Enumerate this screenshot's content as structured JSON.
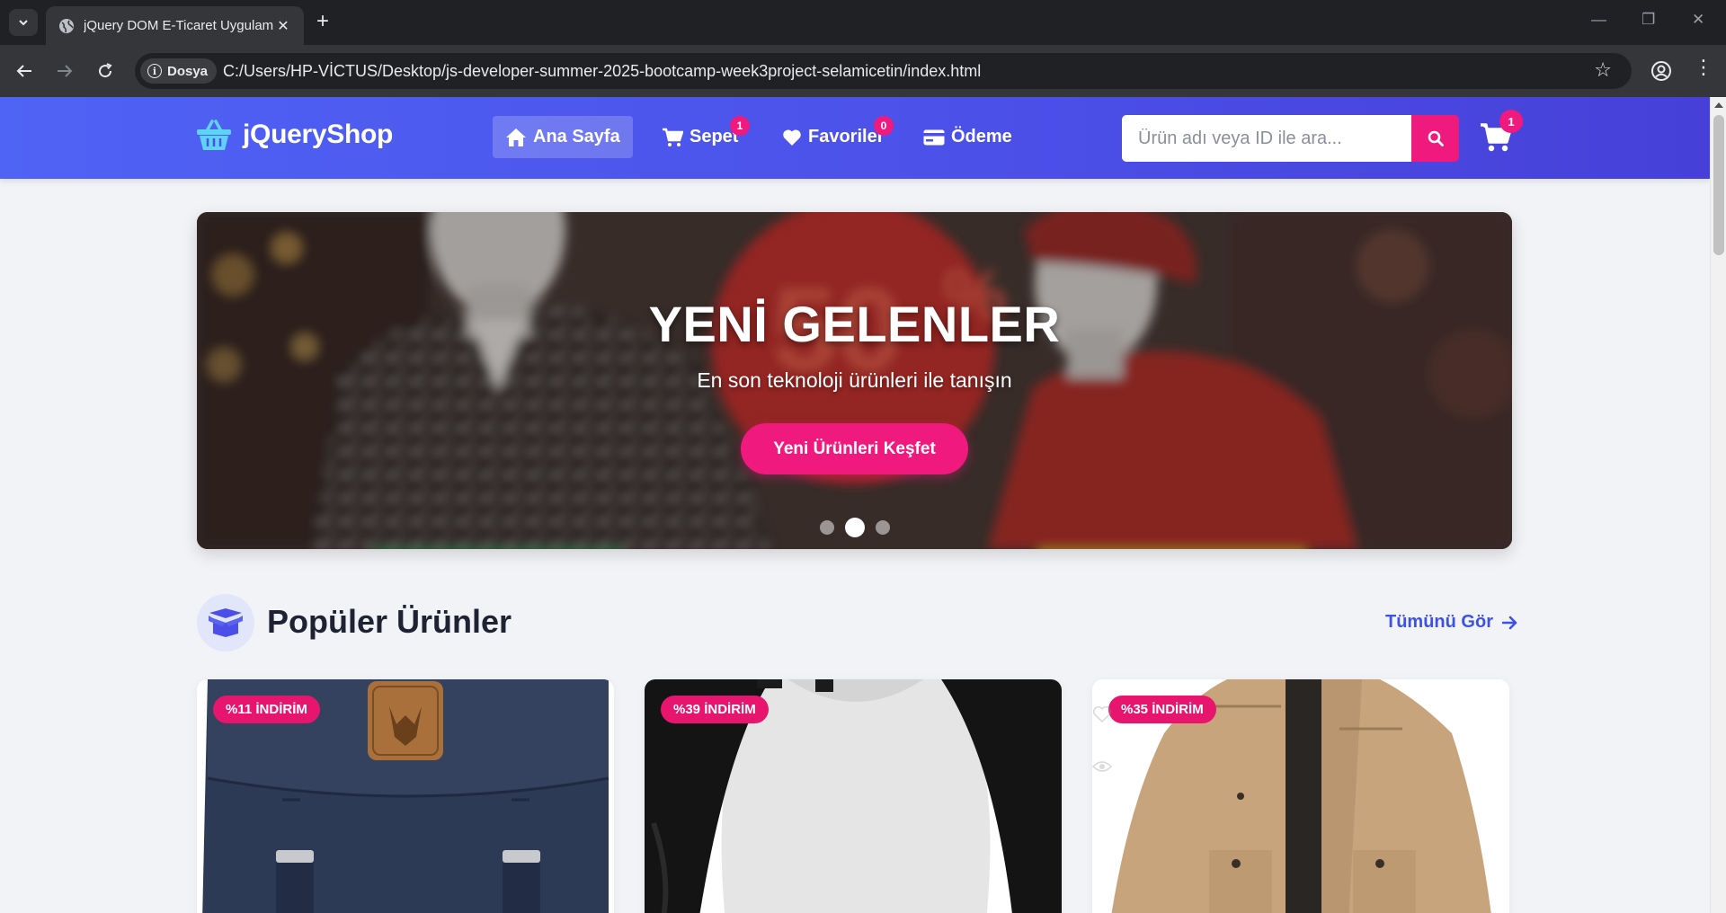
{
  "browser": {
    "tab_title": "jQuery DOM E-Ticaret Uygulam",
    "address_chip": "Dosya",
    "url": "C:/Users/HP-VİCTUS/Desktop/js-developer-summer-2025-bootcamp-week3project-selamicetin/index.html"
  },
  "header": {
    "brand": "jQueryShop",
    "nav": [
      {
        "label": "Ana Sayfa",
        "icon": "home-icon",
        "active": true
      },
      {
        "label": "Sepet",
        "icon": "cart-icon",
        "badge": "1"
      },
      {
        "label": "Favoriler",
        "icon": "heart-icon",
        "badge": "0"
      },
      {
        "label": "Ödeme",
        "icon": "credit-card-icon"
      }
    ],
    "search_placeholder": "Ürün adı veya ID ile ara...",
    "cart_count": "1"
  },
  "hero": {
    "title": "YENİ GELENLER",
    "subtitle": "En son teknoloji ürünleri ile tanışın",
    "cta": "Yeni Ürünleri Keşfet",
    "slides": 3,
    "active_slide": 2
  },
  "section": {
    "title": "Popüler Ürünler",
    "see_all": "Tümünü Gör"
  },
  "products": [
    {
      "discount": "%11 İNDİRİM",
      "image": "navy backpack"
    },
    {
      "discount": "%39 İNDİRİM",
      "image": "raglan long sleeve t-shirt"
    },
    {
      "discount": "%35 İNDİRİM",
      "image": "beige jacket"
    }
  ],
  "colors": {
    "primary": "#4b4fe8",
    "accent": "#f0197d",
    "link": "#3f51e5"
  }
}
